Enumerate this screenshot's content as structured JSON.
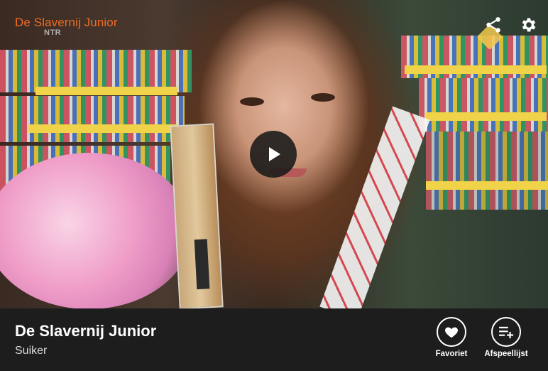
{
  "player": {
    "channel_logo": "De Slavernij Junior",
    "broadcaster": "NTR",
    "icons": {
      "share": "share-icon",
      "settings": "gear-icon",
      "play": "play-icon"
    }
  },
  "episode": {
    "title": "De Slavernij Junior",
    "subtitle": "Suiker"
  },
  "actions": {
    "favorite_label": "Favoriet",
    "playlist_label": "Afspeellijst"
  },
  "colors": {
    "brand_orange": "#f36c21",
    "bar_background": "#1d1d1d",
    "text_white": "#ffffff"
  }
}
